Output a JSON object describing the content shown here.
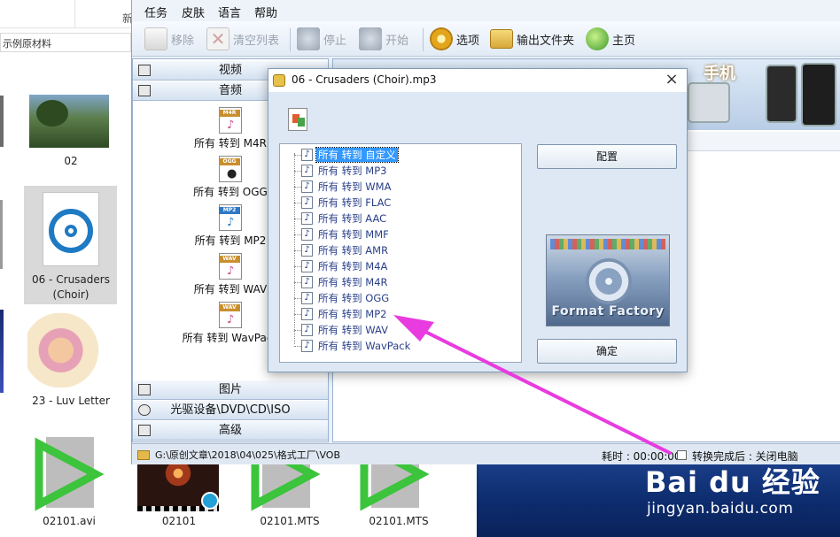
{
  "explorer": {
    "top_fragment": "新",
    "path_fragment": "示例原材料",
    "items": [
      {
        "caption": "02"
      },
      {
        "caption": "06 - Crusaders (Choir)"
      },
      {
        "caption": "23 - Luv Letter"
      },
      {
        "caption": "02101.avi"
      },
      {
        "caption": "02101"
      },
      {
        "caption": "02101.MTS"
      },
      {
        "caption": "02101.MTS"
      }
    ]
  },
  "app": {
    "menu": [
      "任务",
      "皮肤",
      "语言",
      "帮助"
    ],
    "toolbar": {
      "remove": "移除",
      "clear_list": "清空列表",
      "stop": "停止",
      "start": "开始",
      "options": "选项",
      "output_folder": "输出文件夹",
      "home": "主页"
    },
    "categories": {
      "video": "视频",
      "audio": "音频",
      "picture": "图片",
      "rom": "光驱设备\\DVD\\CD\\ISO",
      "advanced": "高级"
    },
    "conversions": [
      {
        "tag": "M4R",
        "label": "所有 转到 M4R"
      },
      {
        "tag": "OGG",
        "label": "所有 转到 OGG"
      },
      {
        "tag": "MP2",
        "label": "所有 转到 MP2"
      },
      {
        "tag": "WAV",
        "label": "所有 转到 WAV"
      },
      {
        "tag": "WAV",
        "label": "所有 转到 WavPack"
      }
    ],
    "banner_text": "手机",
    "status": {
      "path": "G:\\原创文章\\2018\\04\\025\\格式工厂\\VOB",
      "elapsed": "耗时 : 00:00:00",
      "after": "转换完成后 : 关闭电脑"
    }
  },
  "dialog": {
    "title": "06 - Crusaders (Choir).mp3",
    "close": "×",
    "tree": [
      "所有 转到 自定义",
      "所有 转到 MP3",
      "所有 转到 WMA",
      "所有 转到 FLAC",
      "所有 转到 AAC",
      "所有 转到 MMF",
      "所有 转到 AMR",
      "所有 转到 M4A",
      "所有 转到 M4R",
      "所有 转到 OGG",
      "所有 转到 MP2",
      "所有 转到 WAV",
      "所有 转到 WavPack"
    ],
    "selected_index": 0,
    "configure_button": "配置",
    "ok_button": "确定",
    "logo_text": "Format Factory"
  },
  "watermark": {
    "brand": "Bai du 经验",
    "url": "jingyan.baidu.com"
  },
  "colors": {
    "arrow": "#e83be0",
    "selection": "#3399ff",
    "desktop": "#0c2a6b"
  }
}
